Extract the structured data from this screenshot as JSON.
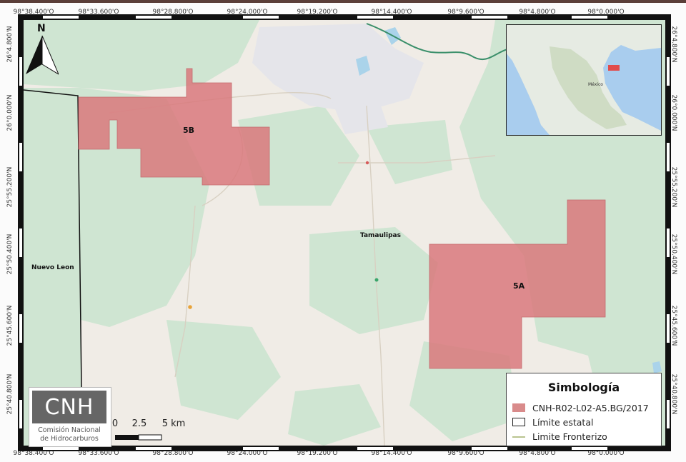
{
  "north_arrow": {
    "label": "N"
  },
  "coordinates": {
    "top": [
      "98°38.400'O",
      "98°33.600'O",
      "98°28.800'O",
      "98°24.000'O",
      "98°19.200'O",
      "98°14.400'O",
      "98°9.600'O",
      "98°4.800'O",
      "98°0.000'O"
    ],
    "bottom": [
      "98°38.400'O",
      "98°33.600'O",
      "98°28.800'O",
      "98°24.000'O",
      "98°19.200'O",
      "98°14.400'O",
      "98°9.600'O",
      "98°4.800'O",
      "98°0.000'O"
    ],
    "left": [
      "26°4.800'N",
      "26°0.000'N",
      "25°55.200'N",
      "25°50.400'N",
      "25°45.600'N",
      "25°40.800'N"
    ],
    "right": [
      "26°4.800'N",
      "26°0.000'N",
      "25°55.200'N",
      "25°50.400'N",
      "25°45.600'N",
      "25°40.800'N"
    ]
  },
  "map_labels": {
    "block_5b": "5B",
    "block_5a": "5A",
    "state_tamaulipas": "Tamaulipas",
    "state_nuevo_leon": "Nuevo Leon"
  },
  "inset": {
    "country_label": "México"
  },
  "legend": {
    "title": "Simbología",
    "items": [
      {
        "label": "CNH-R02-L02-A5.BG/2017",
        "symbol": "fill",
        "color": "#d98b8b"
      },
      {
        "label": "Límite estatal",
        "symbol": "outline",
        "color": "#222222"
      },
      {
        "label": "Limite Fronterizo",
        "symbol": "line",
        "color": "#b9c48f"
      }
    ]
  },
  "logo": {
    "mark": "CNH",
    "line1": "Comisión Nacional",
    "line2": "de Hidrocarburos"
  },
  "scale_bar": {
    "labels": [
      "0",
      "2.5",
      "5 km"
    ]
  },
  "colors": {
    "block_fill": "#d9797d",
    "land_light": "#f0ece6",
    "vegetation": "#cfe5d2",
    "water": "#aad3ea",
    "urban": "#e5e5ea",
    "border_dark": "#111111"
  }
}
